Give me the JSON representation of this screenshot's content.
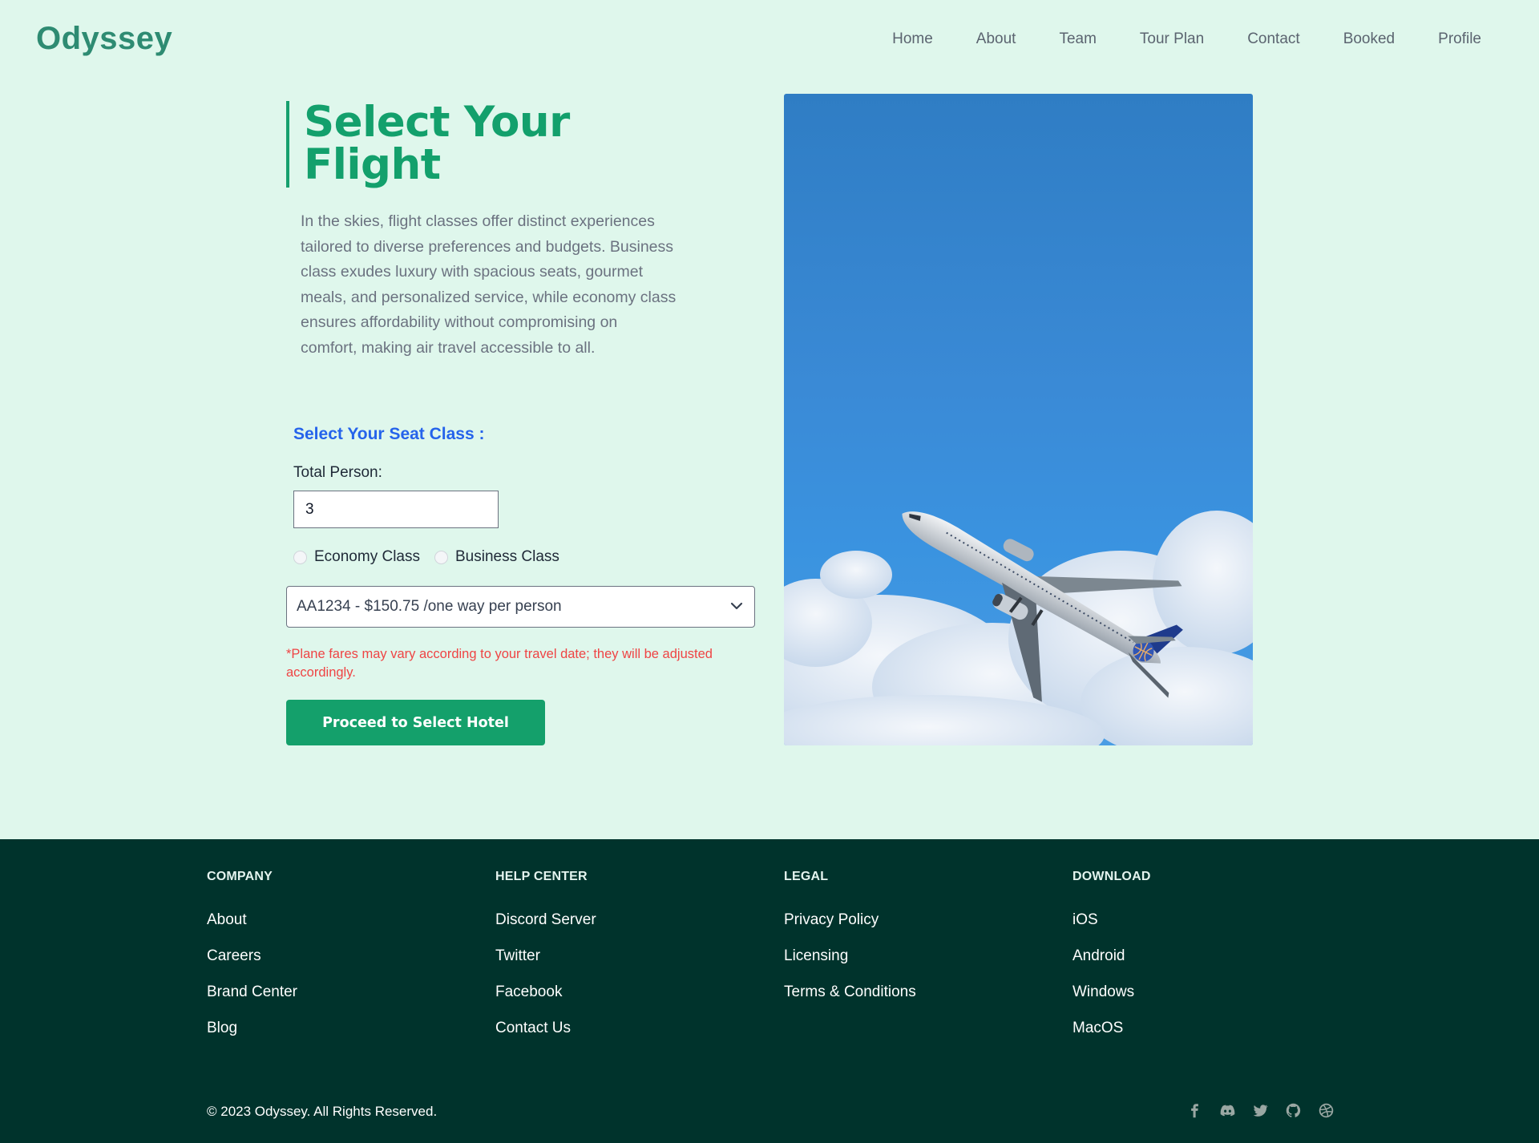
{
  "brand": {
    "logo": "Odyssey"
  },
  "nav": {
    "items": [
      "Home",
      "About",
      "Team",
      "Tour Plan",
      "Contact",
      "Booked",
      "Profile"
    ]
  },
  "main": {
    "title": "Select Your Flight",
    "intro": "In the skies, flight classes offer distinct experiences tailored to diverse preferences and budgets. Business class exudes luxury with spacious seats, gourmet meals, and personalized service, while economy class ensures affordability without compromising on comfort, making air travel accessible to all.",
    "seat_heading": "Select Your Seat Class :",
    "persons_label": "Total Person:",
    "persons_value": "3",
    "class_options": [
      "Economy Class",
      "Business Class"
    ],
    "flight_selected": "AA1234 - $150.75 /one way per person",
    "fare_note": "*Plane fares may vary according to your travel date; they will be adjusted accordingly.",
    "proceed_label": "Proceed to Select Hotel"
  },
  "colors": {
    "background": "#dff7ec",
    "accent": "#14a06b",
    "footer": "#00332c",
    "link_blue": "#2563eb",
    "warning": "#ef4444"
  },
  "footer": {
    "columns": [
      {
        "heading": "COMPANY",
        "links": [
          "About",
          "Careers",
          "Brand Center",
          "Blog"
        ]
      },
      {
        "heading": "HELP CENTER",
        "links": [
          "Discord Server",
          "Twitter",
          "Facebook",
          "Contact Us"
        ]
      },
      {
        "heading": "LEGAL",
        "links": [
          "Privacy Policy",
          "Licensing",
          "Terms & Conditions"
        ]
      },
      {
        "heading": "DOWNLOAD",
        "links": [
          "iOS",
          "Android",
          "Windows",
          "MacOS"
        ]
      }
    ],
    "copyright": "© 2023 Odyssey. All Rights Reserved.",
    "social_icons": [
      "facebook-icon",
      "discord-icon",
      "twitter-icon",
      "github-icon",
      "dribbble-icon"
    ]
  }
}
